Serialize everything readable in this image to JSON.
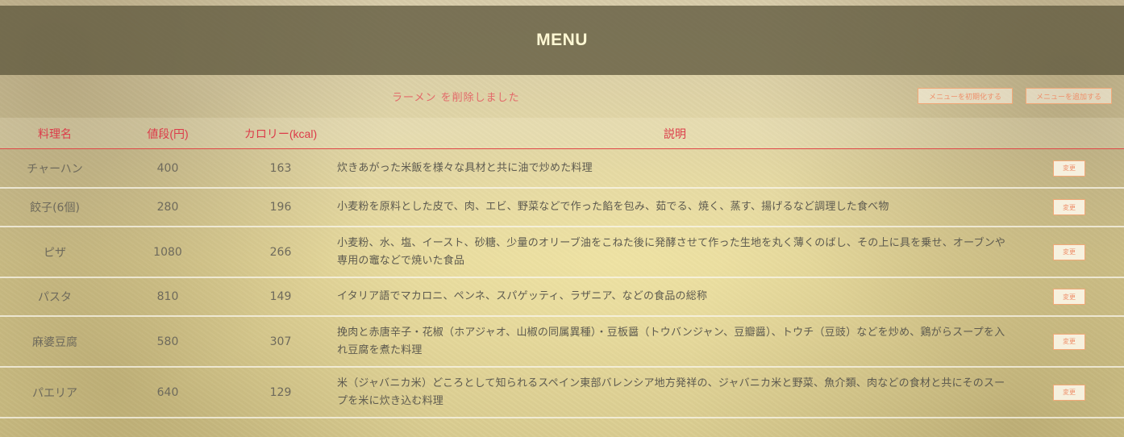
{
  "header": {
    "title": "MENU"
  },
  "status_message": "ラーメン を削除しました",
  "actions": {
    "reset_label": "メニューを初期化する",
    "add_label": "メニューを追加する"
  },
  "table": {
    "columns": [
      "料理名",
      "値段(円)",
      "カロリー(kcal)",
      "説明"
    ],
    "rows": [
      {
        "name": "チャーハン",
        "price": "400",
        "calories": "163",
        "description": "炊きあがった米飯を様々な具材と共に油で炒めた料理",
        "edit_label": "変更"
      },
      {
        "name": "餃子(6個)",
        "price": "280",
        "calories": "196",
        "description": "小麦粉を原料とした皮で、肉、エビ、野菜などで作った餡を包み、茹でる、焼く、蒸す、揚げるなど調理した食べ物",
        "edit_label": "変更"
      },
      {
        "name": "ピザ",
        "price": "1080",
        "calories": "266",
        "description": "小麦粉、水、塩、イースト、砂糖、少量のオリーブ油をこねた後に発酵させて作った生地を丸く薄くのばし、その上に具を乗せ、オーブンや専用の竈などで焼いた食品",
        "edit_label": "変更"
      },
      {
        "name": "パスタ",
        "price": "810",
        "calories": "149",
        "description": "イタリア語でマカロニ、ペンネ、スパゲッティ、ラザニア、などの食品の総称",
        "edit_label": "変更"
      },
      {
        "name": "麻婆豆腐",
        "price": "580",
        "calories": "307",
        "description": "挽肉と赤唐辛子・花椒（ホアジャオ、山椒の同属異種）・豆板醤（トウバンジャン、豆瓣醤）、トウチ（豆豉）などを炒め、鶏がらスープを入れ豆腐を煮た料理",
        "edit_label": "変更"
      },
      {
        "name": "パエリア",
        "price": "640",
        "calories": "129",
        "description": "米（ジャバニカ米）どころとして知られるスペイン東部バレンシア地方発祥の、ジャバニカ米と野菜、魚介類、肉などの食材と共にそのスープを米に炊き込む料理",
        "edit_label": "変更"
      }
    ]
  },
  "colors": {
    "header_bg": "#5f583e",
    "header_text": "#fff8d4",
    "accent_red": "#dc3c4a",
    "message_text": "#e36a6a",
    "button_border": "#f2a978",
    "button_text": "#ee8f6a"
  }
}
